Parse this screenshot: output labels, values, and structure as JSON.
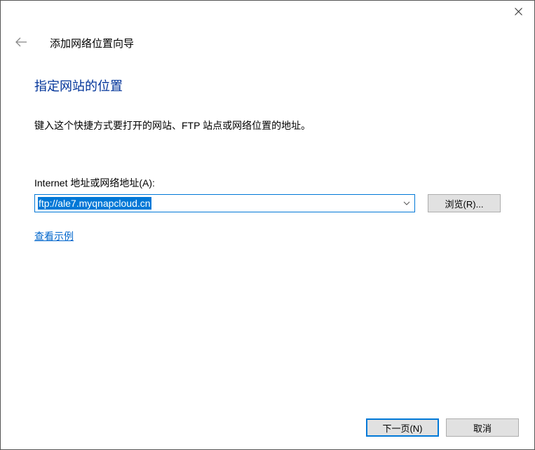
{
  "window": {
    "wizard_title": "添加网络位置向导"
  },
  "step": {
    "heading": "指定网站的位置",
    "instruction": "键入这个快捷方式要打开的网站、FTP 站点或网络位置的地址。",
    "address_label": "Internet 地址或网络地址(A):",
    "address_value": "ftp://ale7.myqnapcloud.cn",
    "browse_button": "浏览(R)...",
    "example_link": "查看示例"
  },
  "buttons": {
    "next": "下一页(N)",
    "cancel": "取消"
  }
}
